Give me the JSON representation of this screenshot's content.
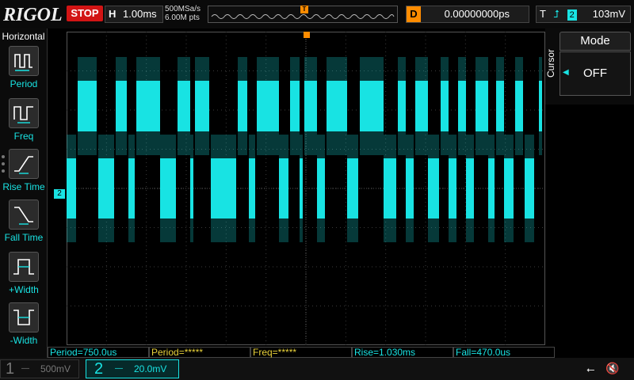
{
  "brand": {
    "logo": "RIGOL"
  },
  "top": {
    "run_state": "STOP",
    "horizontal_label": "H",
    "timebase": "1.00ms",
    "sample_rate": "500MSa/s",
    "memory_depth": "6.00M pts",
    "trigger_marker": "T",
    "delay_label": "D",
    "delay_value": "0.00000000ps",
    "trigger_label": "T",
    "trigger_channel": "2",
    "trigger_level": "103mV"
  },
  "left_panel": {
    "title": "Horizontal",
    "items": [
      {
        "label": "Period",
        "icon": "period-icon"
      },
      {
        "label": "Freq",
        "icon": "freq-icon"
      },
      {
        "label": "Rise Time",
        "icon": "rise-time-icon"
      },
      {
        "label": "Fall Time",
        "icon": "fall-time-icon"
      },
      {
        "label": "+Width",
        "icon": "pos-width-icon"
      },
      {
        "label": "-Width",
        "icon": "neg-width-icon"
      }
    ]
  },
  "cursor_panel": {
    "side_label": "Cursor",
    "mode_label": "Mode",
    "mode_value": "OFF"
  },
  "channel_marker": "2",
  "measurements": [
    {
      "text": "Period=750.0us",
      "color": "#19e3e3"
    },
    {
      "text": "Period=*****",
      "color": "#e8d13a"
    },
    {
      "text": "Freq=*****",
      "color": "#e8d13a"
    },
    {
      "text": "Rise=1.030ms",
      "color": "#19e3e3"
    },
    {
      "text": "Fall=470.0us",
      "color": "#19e3e3"
    }
  ],
  "channels": [
    {
      "number": "1",
      "coupling": "—",
      "scale": "500mV",
      "active": false
    },
    {
      "number": "2",
      "coupling": "—",
      "scale": "20.0mV",
      "active": true
    }
  ],
  "colors": {
    "ch2": "#19e3e3",
    "trigger": "#ff8c00",
    "stop": "#d21414",
    "meas_yellow": "#e8d13a"
  }
}
